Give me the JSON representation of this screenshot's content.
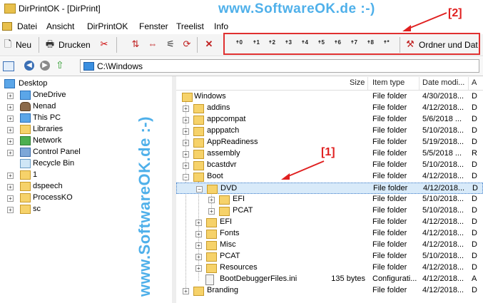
{
  "window": {
    "title": "DirPrintOK - [DirPrint]"
  },
  "watermark_top": "www.SoftwareOK.de :-)",
  "watermark_side": "www.SoftwareOK.de :-)",
  "menu": [
    "Datei",
    "Ansicht",
    "DirPrintOK",
    "Fenster",
    "Treelist",
    "Info"
  ],
  "toolbar": {
    "new_label": "Neu",
    "print_label": "Drucken",
    "levels": [
      "0",
      "1",
      "2",
      "3",
      "4",
      "5",
      "6",
      "7",
      "8",
      "*"
    ],
    "folder_files_label": "Ordner und Dat"
  },
  "annotations": {
    "one": "[1]",
    "two": "[2]"
  },
  "address": {
    "path": "C:\\Windows"
  },
  "tree": [
    {
      "label": "Desktop"
    },
    {
      "label": "OneDrive"
    },
    {
      "label": "Nenad"
    },
    {
      "label": "This PC"
    },
    {
      "label": "Libraries"
    },
    {
      "label": "Network"
    },
    {
      "label": "Control Panel"
    },
    {
      "label": "Recycle Bin"
    },
    {
      "label": "1"
    },
    {
      "label": "dspeech"
    },
    {
      "label": "ProcessKO"
    },
    {
      "label": "sc"
    }
  ],
  "columns": {
    "name": "",
    "size": "Size",
    "type": "Item type",
    "date": "Date modi...",
    "attr": "A"
  },
  "files": [
    {
      "name": "Windows",
      "size": "",
      "type": "File folder",
      "date": "4/30/2018...",
      "attr": "D"
    },
    {
      "name": "addins",
      "size": "",
      "type": "File folder",
      "date": "4/12/2018...",
      "attr": "D"
    },
    {
      "name": "appcompat",
      "size": "",
      "type": "File folder",
      "date": "5/6/2018 ...",
      "attr": "D"
    },
    {
      "name": "apppatch",
      "size": "",
      "type": "File folder",
      "date": "5/10/2018...",
      "attr": "D"
    },
    {
      "name": "AppReadiness",
      "size": "",
      "type": "File folder",
      "date": "5/19/2018...",
      "attr": "D"
    },
    {
      "name": "assembly",
      "size": "",
      "type": "File folder",
      "date": "5/5/2018 ...",
      "attr": "R"
    },
    {
      "name": "bcastdvr",
      "size": "",
      "type": "File folder",
      "date": "5/10/2018...",
      "attr": "D"
    },
    {
      "name": "Boot",
      "size": "",
      "type": "File folder",
      "date": "4/12/2018...",
      "attr": "D"
    },
    {
      "name": "DVD",
      "size": "",
      "type": "File folder",
      "date": "4/12/2018...",
      "attr": "D"
    },
    {
      "name": "EFI",
      "size": "",
      "type": "File folder",
      "date": "5/10/2018...",
      "attr": "D"
    },
    {
      "name": "PCAT",
      "size": "",
      "type": "File folder",
      "date": "5/10/2018...",
      "attr": "D"
    },
    {
      "name": "EFI",
      "size": "",
      "type": "File folder",
      "date": "4/12/2018...",
      "attr": "D"
    },
    {
      "name": "Fonts",
      "size": "",
      "type": "File folder",
      "date": "4/12/2018...",
      "attr": "D"
    },
    {
      "name": "Misc",
      "size": "",
      "type": "File folder",
      "date": "4/12/2018...",
      "attr": "D"
    },
    {
      "name": "PCAT",
      "size": "",
      "type": "File folder",
      "date": "5/10/2018...",
      "attr": "D"
    },
    {
      "name": "Resources",
      "size": "",
      "type": "File folder",
      "date": "4/12/2018...",
      "attr": "D"
    },
    {
      "name": "BootDebuggerFiles.ini",
      "size": "135 bytes",
      "type": "Configurati...",
      "date": "4/12/2018...",
      "attr": "A"
    },
    {
      "name": "Branding",
      "size": "",
      "type": "File folder",
      "date": "4/12/2018...",
      "attr": "D"
    }
  ]
}
